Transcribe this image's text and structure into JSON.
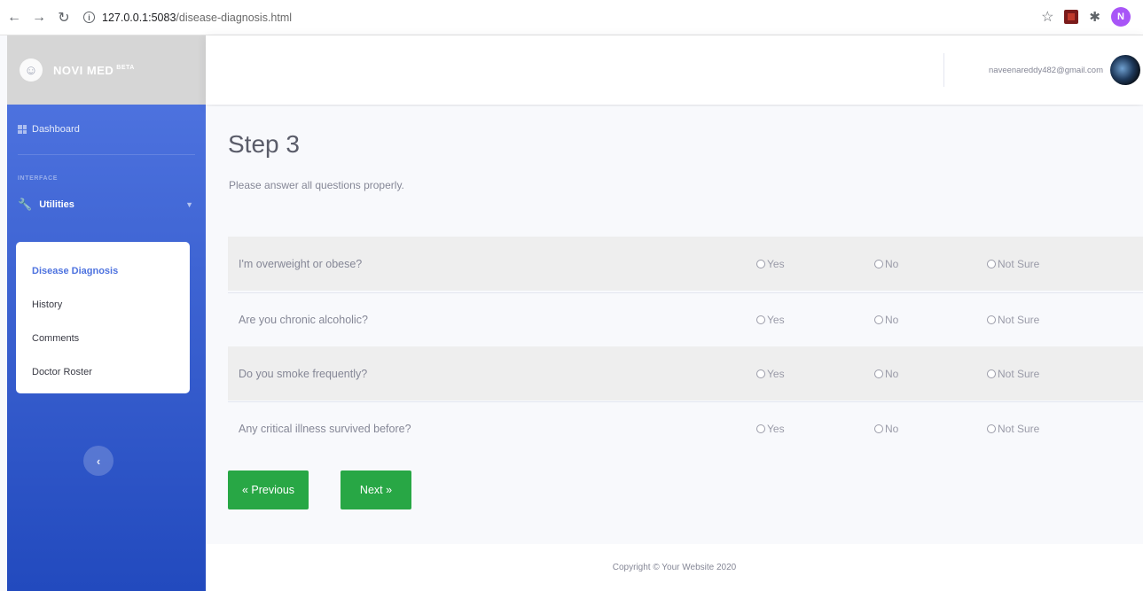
{
  "browser": {
    "url_host": "127.0.0.1:5083",
    "url_path": "/disease-diagnosis.html",
    "profile_initial": "N"
  },
  "brand": {
    "name": "NOVI MED",
    "tag": "BETA"
  },
  "sidebar": {
    "dashboard": "Dashboard",
    "heading": "INTERFACE",
    "utilities": "Utilities",
    "items": [
      {
        "label": "Disease Diagnosis",
        "active": true
      },
      {
        "label": "History",
        "active": false
      },
      {
        "label": "Comments",
        "active": false
      },
      {
        "label": "Doctor Roster",
        "active": false
      }
    ]
  },
  "topbar": {
    "user_email": "naveenareddy482@gmail.com"
  },
  "main": {
    "title": "Step 3",
    "subtitle": "Please answer all questions properly.",
    "options": [
      "Yes",
      "No",
      "Not Sure"
    ],
    "questions": [
      "I'm overweight or obese?",
      "Are you chronic alcoholic?",
      "Do you smoke frequently?",
      "Any critical illness survived before?"
    ],
    "prev_label": "« Previous",
    "next_label": "Next »"
  },
  "footer": {
    "text": "Copyright © Your Website 2020"
  },
  "colors": {
    "primary": "#4e73df",
    "success": "#28a745",
    "text_muted": "#858796"
  }
}
